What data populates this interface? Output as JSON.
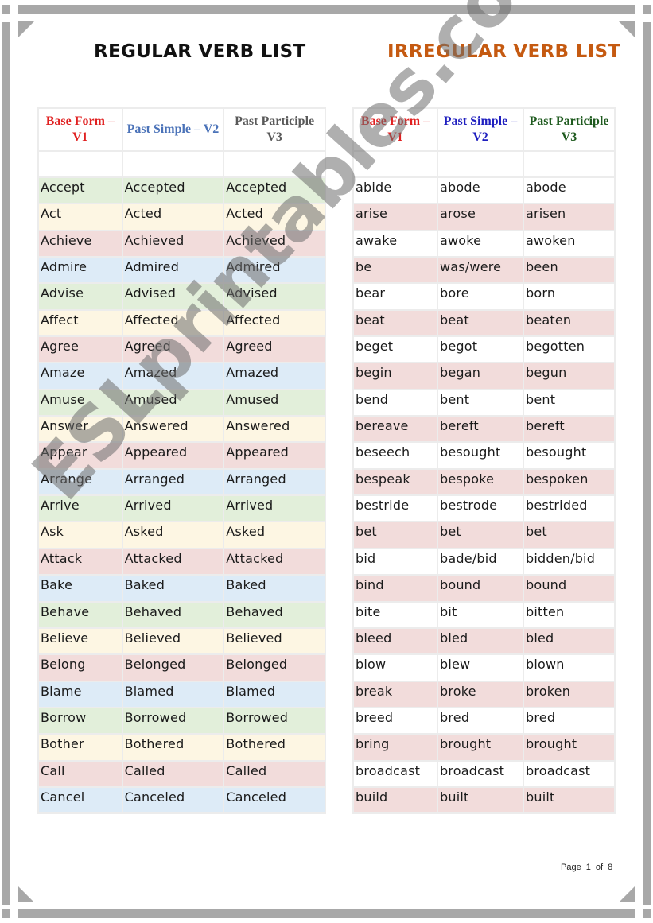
{
  "regular": {
    "title": "REGULAR VERB LIST",
    "headers": [
      {
        "label": "Base Form – V1",
        "color": "#e02020"
      },
      {
        "label": "Past Simple – V2",
        "color": "#4a72b8"
      },
      {
        "label": "Past Participle V3",
        "color": "#595959"
      }
    ],
    "rows": [
      {
        "v1": "Accept",
        "v2": "Accepted",
        "v3": "Accepted",
        "tone": "green"
      },
      {
        "v1": "Act",
        "v2": "Acted",
        "v3": "Acted",
        "tone": "yellow"
      },
      {
        "v1": "Achieve",
        "v2": "Achieved",
        "v3": "Achieved",
        "tone": "pink"
      },
      {
        "v1": "Admire",
        "v2": "Admired",
        "v3": "Admired",
        "tone": "blue"
      },
      {
        "v1": "Advise",
        "v2": "Advised",
        "v3": "Advised",
        "tone": "green"
      },
      {
        "v1": "Affect",
        "v2": "Affected",
        "v3": "Affected",
        "tone": "yellow"
      },
      {
        "v1": "Agree",
        "v2": "Agreed",
        "v3": "Agreed",
        "tone": "pink"
      },
      {
        "v1": "Amaze",
        "v2": "Amazed",
        "v3": "Amazed",
        "tone": "blue"
      },
      {
        "v1": "Amuse",
        "v2": "Amused",
        "v3": "Amused",
        "tone": "green"
      },
      {
        "v1": "Answer",
        "v2": "Answered",
        "v3": "Answered",
        "tone": "yellow"
      },
      {
        "v1": "Appear",
        "v2": "Appeared",
        "v3": "Appeared",
        "tone": "pink"
      },
      {
        "v1": "Arrange",
        "v2": "Arranged",
        "v3": "Arranged",
        "tone": "blue"
      },
      {
        "v1": "Arrive",
        "v2": "Arrived",
        "v3": "Arrived",
        "tone": "green"
      },
      {
        "v1": "Ask",
        "v2": "Asked",
        "v3": "Asked",
        "tone": "yellow"
      },
      {
        "v1": "Attack",
        "v2": "Attacked",
        "v3": "Attacked",
        "tone": "pink"
      },
      {
        "v1": "Bake",
        "v2": "Baked",
        "v3": "Baked",
        "tone": "blue"
      },
      {
        "v1": "Behave",
        "v2": "Behaved",
        "v3": "Behaved",
        "tone": "green"
      },
      {
        "v1": "Believe",
        "v2": "Believed",
        "v3": "Believed",
        "tone": "yellow"
      },
      {
        "v1": "Belong",
        "v2": "Belonged",
        "v3": "Belonged",
        "tone": "pink"
      },
      {
        "v1": "Blame",
        "v2": "Blamed",
        "v3": "Blamed",
        "tone": "blue"
      },
      {
        "v1": "Borrow",
        "v2": "Borrowed",
        "v3": "Borrowed",
        "tone": "green"
      },
      {
        "v1": "Bother",
        "v2": "Bothered",
        "v3": "Bothered",
        "tone": "yellow"
      },
      {
        "v1": "Call",
        "v2": "Called",
        "v3": "Called",
        "tone": "pink"
      },
      {
        "v1": "Cancel",
        "v2": "Canceled",
        "v3": "Canceled",
        "tone": "blue"
      }
    ]
  },
  "irregular": {
    "title": "IRREGULAR VERB LIST",
    "headers": [
      {
        "label": "Base Form – V1",
        "color": "#e02020"
      },
      {
        "label": "Past Simple – V2",
        "color": "#1f1fbf"
      },
      {
        "label": "Past Participle V3",
        "color": "#1e5a1e"
      }
    ],
    "rows": [
      {
        "v1": "abide",
        "v2": "abode",
        "v3": "abode",
        "tone": "white"
      },
      {
        "v1": "arise",
        "v2": "arose",
        "v3": "arisen",
        "tone": "pink"
      },
      {
        "v1": "awake",
        "v2": "awoke",
        "v3": "awoken",
        "tone": "white"
      },
      {
        "v1": "be",
        "v2": "was/were",
        "v3": "been",
        "tone": "pink"
      },
      {
        "v1": "bear",
        "v2": "bore",
        "v3": "born",
        "tone": "white"
      },
      {
        "v1": "beat",
        "v2": "beat",
        "v3": "beaten",
        "tone": "pink"
      },
      {
        "v1": "beget",
        "v2": "begot",
        "v3": "begotten",
        "tone": "white"
      },
      {
        "v1": "begin",
        "v2": "began",
        "v3": "begun",
        "tone": "pink"
      },
      {
        "v1": "bend",
        "v2": "bent",
        "v3": "bent",
        "tone": "white"
      },
      {
        "v1": "bereave",
        "v2": "bereft",
        "v3": "bereft",
        "tone": "pink"
      },
      {
        "v1": "beseech",
        "v2": "besought",
        "v3": "besought",
        "tone": "white"
      },
      {
        "v1": "bespeak",
        "v2": "bespoke",
        "v3": "bespoken",
        "tone": "pink"
      },
      {
        "v1": "bestride",
        "v2": "bestrode",
        "v3": "bestrided",
        "tone": "white"
      },
      {
        "v1": "bet",
        "v2": "bet",
        "v3": "bet",
        "tone": "pink"
      },
      {
        "v1": "bid",
        "v2": "bade/bid",
        "v3": "bidden/bid",
        "tone": "white"
      },
      {
        "v1": "bind",
        "v2": "bound",
        "v3": "bound",
        "tone": "pink"
      },
      {
        "v1": "bite",
        "v2": "bit",
        "v3": "bitten",
        "tone": "white"
      },
      {
        "v1": "bleed",
        "v2": "bled",
        "v3": "bled",
        "tone": "pink"
      },
      {
        "v1": "blow",
        "v2": "blew",
        "v3": "blown",
        "tone": "white"
      },
      {
        "v1": "break",
        "v2": "broke",
        "v3": "broken",
        "tone": "pink"
      },
      {
        "v1": "breed",
        "v2": "bred",
        "v3": "bred",
        "tone": "white"
      },
      {
        "v1": "bring",
        "v2": "brought",
        "v3": "brought",
        "tone": "pink"
      },
      {
        "v1": "broadcast",
        "v2": "broadcast",
        "v3": "broadcast",
        "tone": "white"
      },
      {
        "v1": "build",
        "v2": "built",
        "v3": "built",
        "tone": "pink"
      }
    ]
  },
  "footer": {
    "page_label": "Page 1 of 8"
  },
  "watermark": "ESLprintables.com",
  "colors": {
    "regular_title": "#111111",
    "irregular_title": "#c55a11",
    "green": "#e2efda",
    "yellow": "#fdf6e3",
    "pink": "#f2dcdb",
    "blue": "#ddebf7"
  }
}
